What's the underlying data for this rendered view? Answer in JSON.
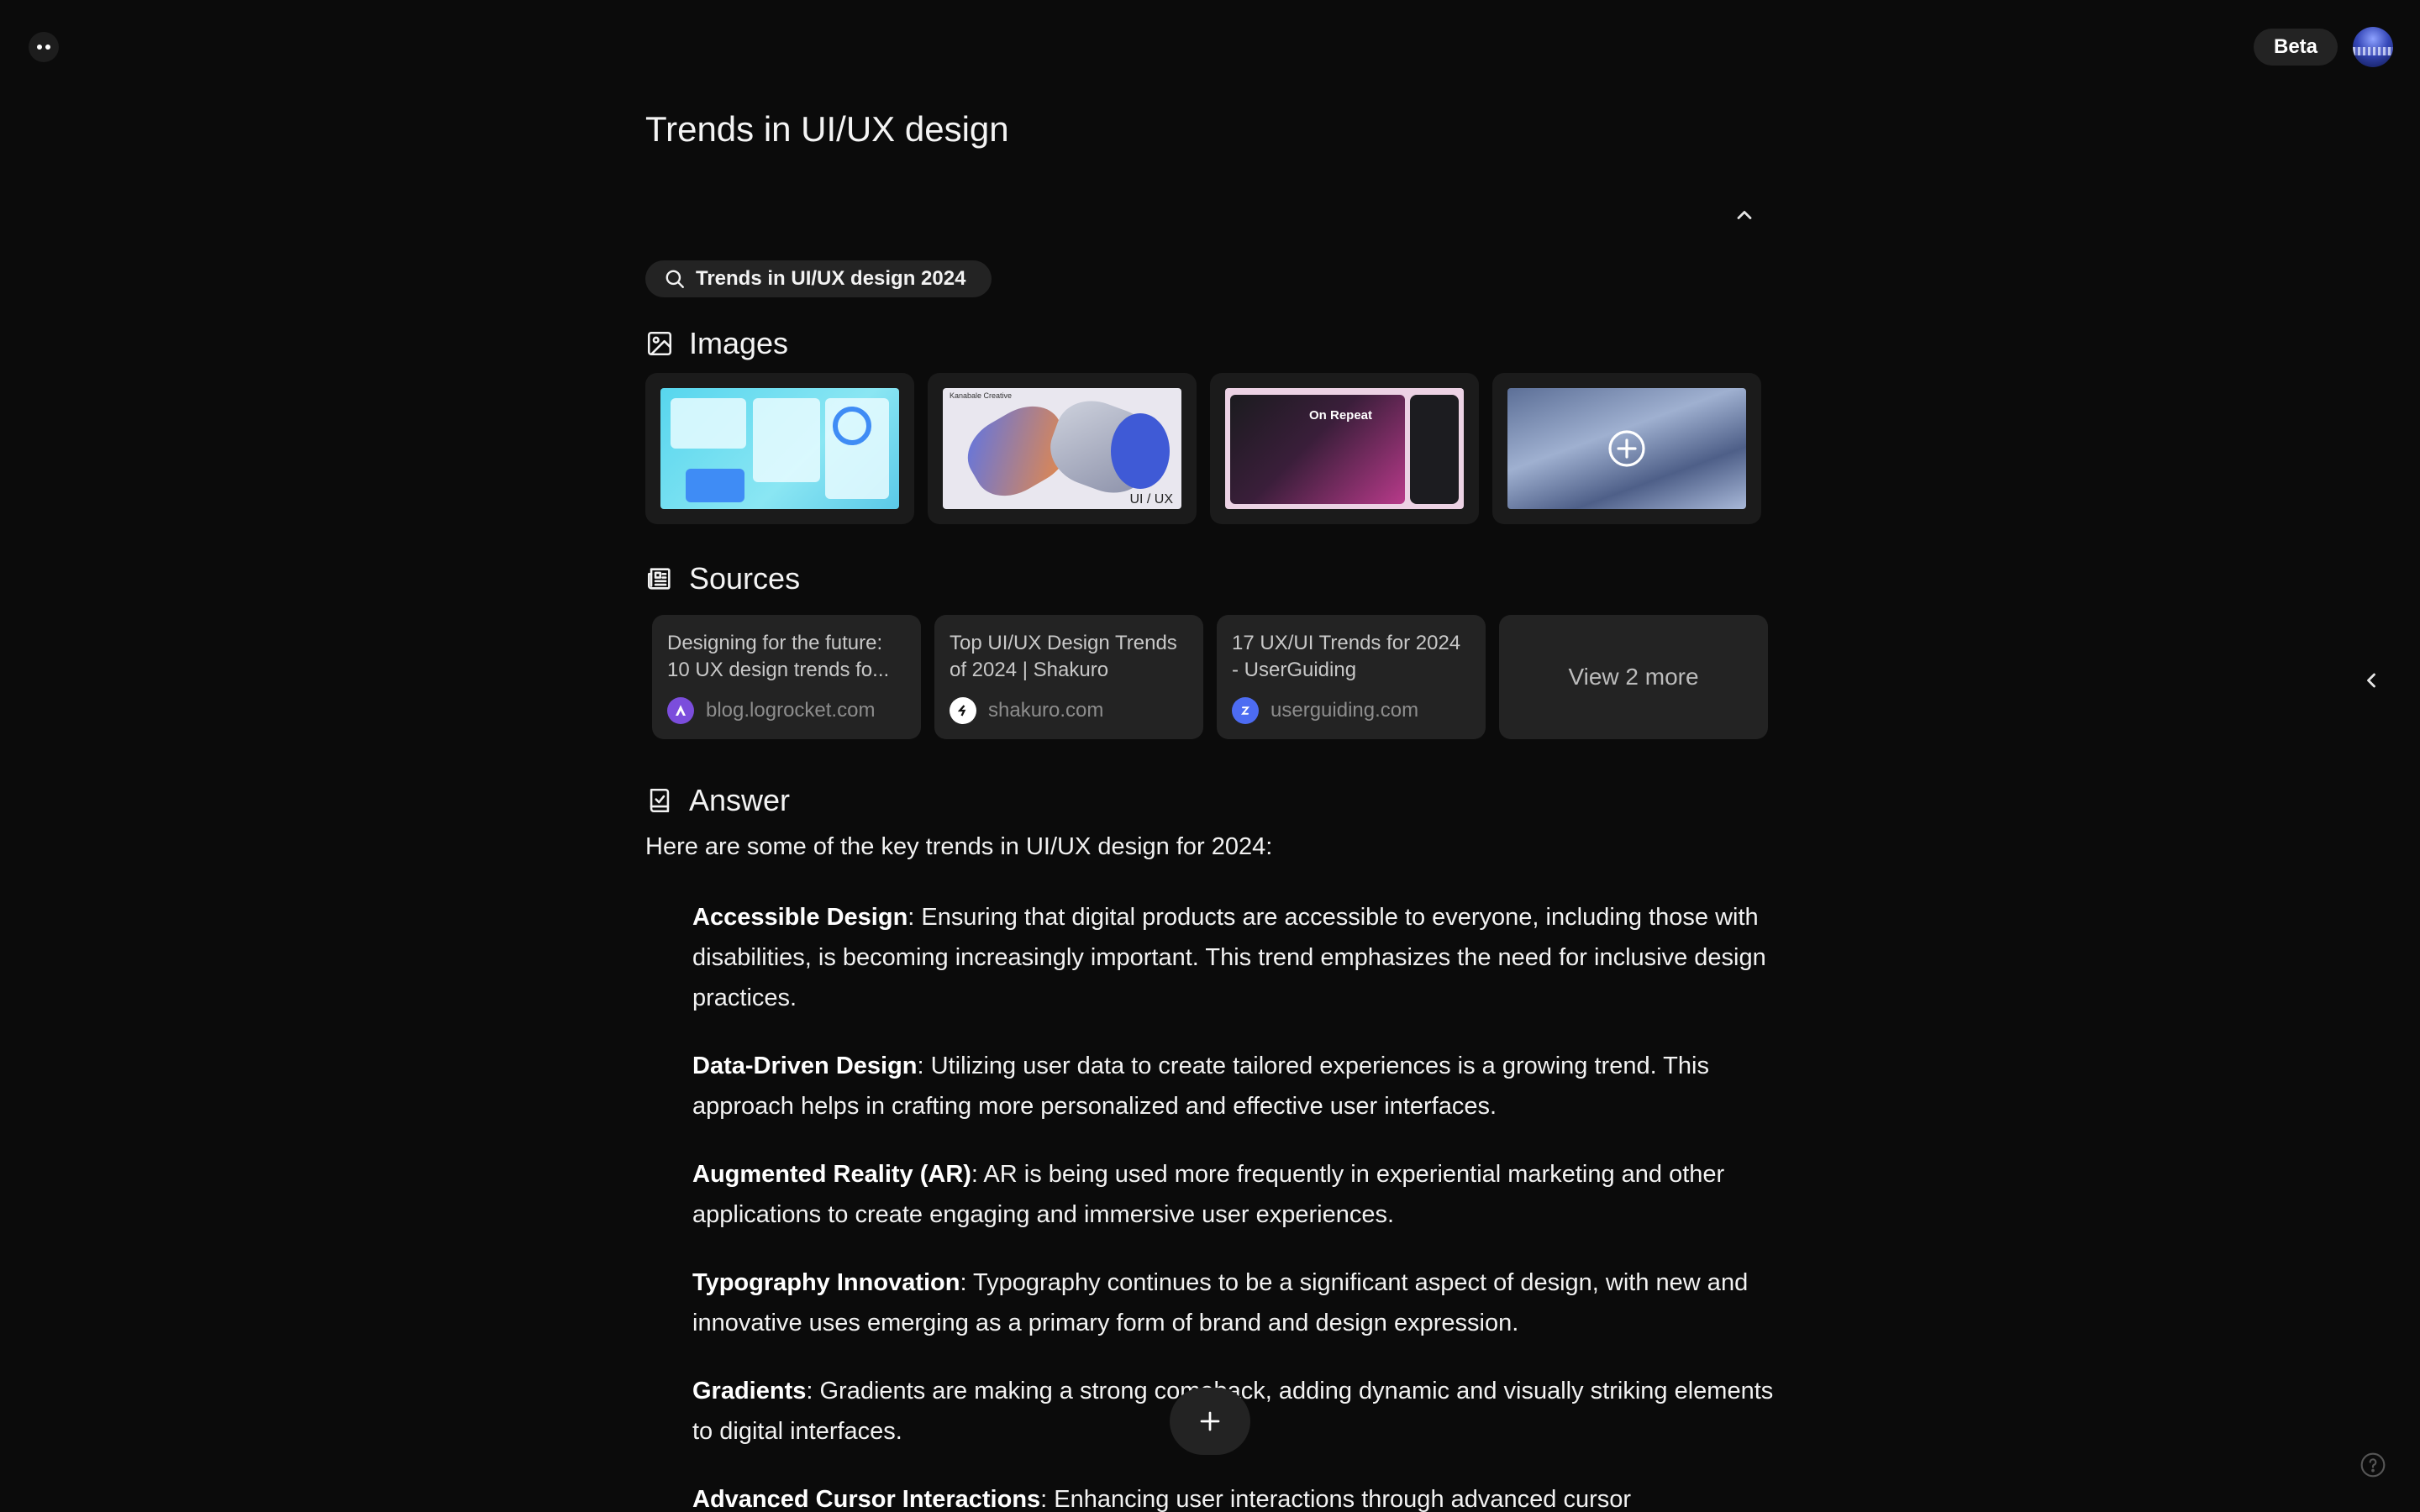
{
  "header": {
    "beta_label": "Beta"
  },
  "page": {
    "title": "Trends in UI/UX design"
  },
  "query": {
    "text": "Trends in UI/UX design 2024"
  },
  "images": {
    "heading": "Images",
    "items": [
      {
        "alt": "dashboard"
      },
      {
        "alt": "uiux",
        "brand": "Kanabale Creative",
        "tag": "UI / UX"
      },
      {
        "alt": "music app",
        "label": "On Repeat"
      },
      {
        "alt": "more"
      }
    ]
  },
  "sources": {
    "heading": "Sources",
    "items": [
      {
        "title": "Designing for the future: 10 UX design trends fo...",
        "domain": "blog.logrocket.com"
      },
      {
        "title": "Top UI/UX Design Trends of 2024 | Shakuro",
        "domain": "shakuro.com"
      },
      {
        "title": "17 UX/UI Trends for 2024 - UserGuiding",
        "domain": "userguiding.com"
      }
    ],
    "more_label": "View 2 more"
  },
  "answer": {
    "heading": "Answer",
    "intro": "Here are some of the key trends in UI/UX design for 2024:",
    "items": [
      {
        "term": "Accessible Design",
        "text": ": Ensuring that digital products are accessible to everyone, including those with disabilities, is becoming increasingly important. This trend emphasizes the need for inclusive design practices."
      },
      {
        "term": "Data-Driven Design",
        "text": ": Utilizing user data to create tailored experiences is a growing trend. This approach helps in crafting more personalized and effective user interfaces."
      },
      {
        "term": "Augmented Reality (AR)",
        "text": ": AR is being used more frequently in experiential marketing and other applications to create engaging and immersive user experiences."
      },
      {
        "term": "Typography Innovation",
        "text": ": Typography continues to be a significant aspect of design, with new and innovative uses emerging as a primary form of brand and design expression."
      },
      {
        "term": "Gradients",
        "text": ": Gradients are making a strong comeback, adding dynamic and visually striking elements to digital interfaces."
      },
      {
        "term": "Advanced Cursor Interactions",
        "text": ": Enhancing user interactions through advanced cursor"
      }
    ]
  },
  "icons": {
    "menu": "more-dots-icon",
    "collapse": "chevron-up-icon",
    "search": "search-icon",
    "images": "image-icon",
    "sources": "newspaper-icon",
    "answer": "answer-icon",
    "add": "plus-icon",
    "side_panel": "chevron-left-icon",
    "help": "help-icon"
  },
  "colors": {
    "background": "#0b0b0b",
    "card": "#232323",
    "text": "#f2f2f2",
    "muted": "#8d8d8d"
  }
}
